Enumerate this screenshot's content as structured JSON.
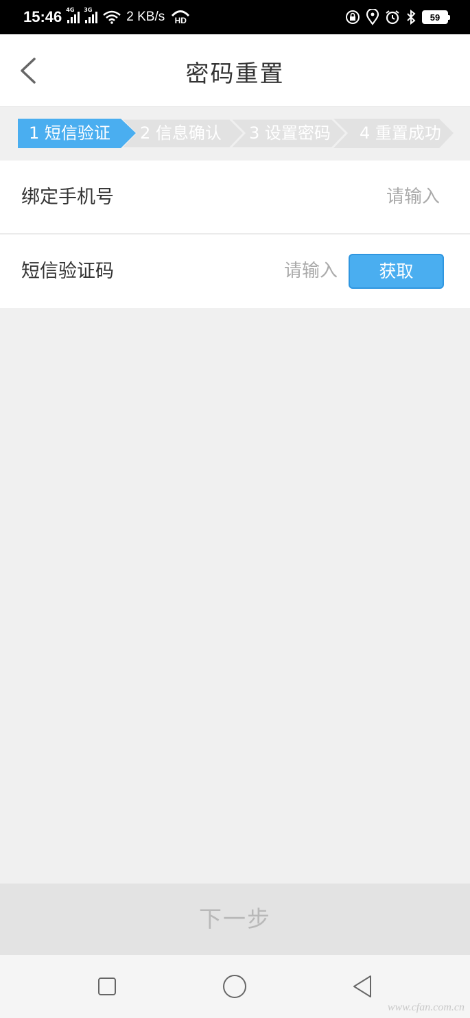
{
  "status_bar": {
    "time": "15:46",
    "network_1": "4G",
    "network_2": "3G",
    "speed": "2 KB/s",
    "hd_badge": "HD",
    "battery": "59",
    "icons": [
      "signal-icon",
      "wifi-icon",
      "hd-call-icon",
      "lock-rotation-icon",
      "location-icon",
      "alarm-icon",
      "bluetooth-icon",
      "battery-icon"
    ]
  },
  "header": {
    "title": "密码重置",
    "back_icon": "chevron-left-icon"
  },
  "steps": [
    {
      "label": "1 短信验证",
      "active": true
    },
    {
      "label": "2 信息确认",
      "active": false
    },
    {
      "label": "3 设置密码",
      "active": false
    },
    {
      "label": "4 重置成功",
      "active": false
    }
  ],
  "form": {
    "phone": {
      "label": "绑定手机号",
      "placeholder": "请输入",
      "value": ""
    },
    "sms": {
      "label": "短信验证码",
      "placeholder": "请输入",
      "value": "",
      "button": "获取"
    }
  },
  "next_button": "下一步",
  "nav": [
    "square-recent-icon",
    "circle-home-icon",
    "triangle-back-icon"
  ],
  "watermark": "www.cfan.com.cn",
  "colors": {
    "accent": "#4aaef0",
    "step_inactive": "#e2e2e2",
    "background": "#f0f0f0"
  }
}
